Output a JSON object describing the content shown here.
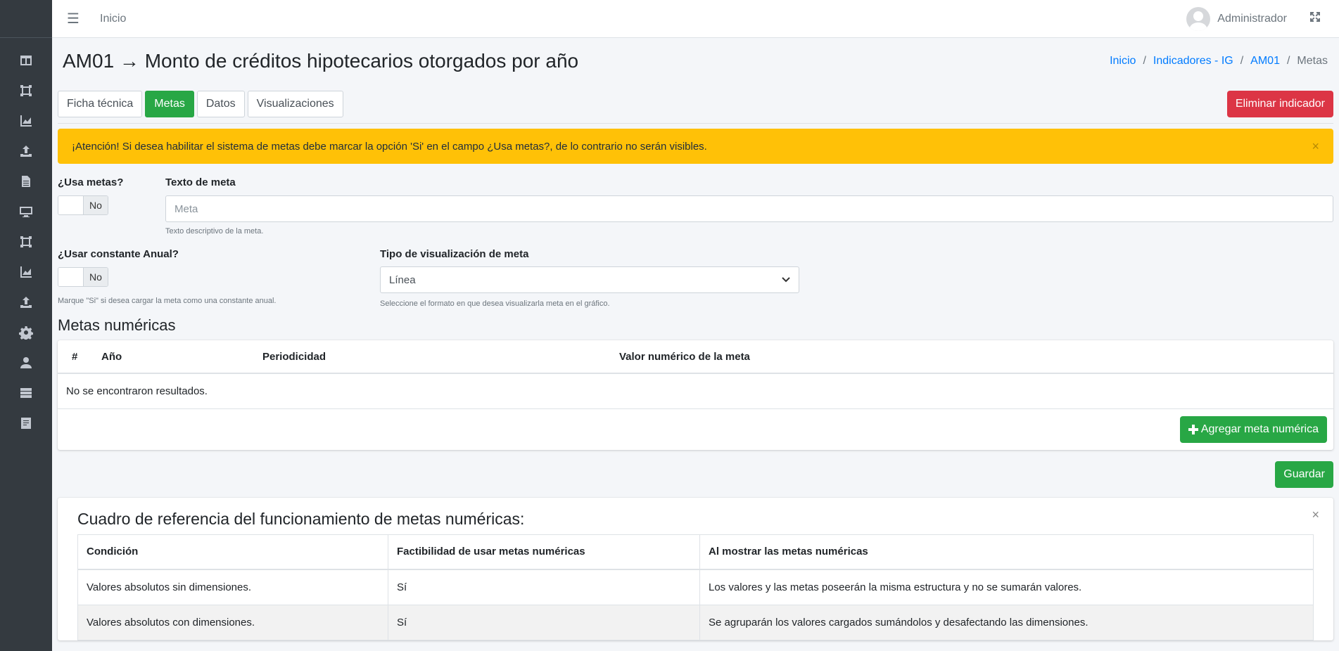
{
  "topbar": {
    "home_link": "Inicio",
    "user_name": "Administrador"
  },
  "page": {
    "title": "AM01 → Monto de créditos hipotecarios otorgados por año"
  },
  "breadcrumb": {
    "items": [
      "Inicio",
      "Indicadores - IG",
      "AM01"
    ],
    "active": "Metas",
    "separator": "/"
  },
  "tabs": [
    {
      "label": "Ficha técnica",
      "active": false
    },
    {
      "label": "Metas",
      "active": true
    },
    {
      "label": "Datos",
      "active": false
    },
    {
      "label": "Visualizaciones",
      "active": false
    }
  ],
  "delete_button": "Eliminar indicador",
  "alert": {
    "text": "¡Atención! Si desea habilitar el sistema de metas debe marcar la opción 'Si' en el campo ¿Usa metas?, de lo contrario no serán visibles.",
    "close": "×"
  },
  "form": {
    "usa_metas": {
      "label": "¿Usa metas?",
      "state": "No"
    },
    "texto_meta": {
      "label": "Texto de meta",
      "placeholder": "Meta",
      "hint": "Texto descriptivo de la meta."
    },
    "constante_anual": {
      "label": "¿Usar constante Anual?",
      "state": "No",
      "hint": "Marque \"Si\" si desea cargar la meta como una constante anual."
    },
    "tipo_visualizacion": {
      "label": "Tipo de visualización de meta",
      "value": "Línea",
      "hint": "Seleccione el formato en que desea visualizarla meta en el gráfico."
    }
  },
  "metas_numericas": {
    "title": "Metas numéricas",
    "columns": [
      "#",
      "Año",
      "Periodicidad",
      "Valor numérico de la meta"
    ],
    "empty_text": "No se encontraron resultados.",
    "add_button": "Agregar meta numérica"
  },
  "save_button": "Guardar",
  "reference": {
    "title": "Cuadro de referencia del funcionamiento de metas numéricas:",
    "close": "×",
    "columns": [
      "Condición",
      "Factibilidad de usar metas numéricas",
      "Al mostrar las metas numéricas"
    ],
    "rows": [
      [
        "Valores absolutos sin dimensiones.",
        "Sí",
        "Los valores y las metas poseerán la misma estructura y no se sumarán valores."
      ],
      [
        "Valores absolutos con dimensiones.",
        "Sí",
        "Se agruparán los valores cargados sumándolos y desafectando las dimensiones."
      ]
    ]
  },
  "colors": {
    "sidebar": "#343a40",
    "success": "#28a745",
    "danger": "#dc3545",
    "warning": "#ffc107",
    "link": "#007bff"
  }
}
